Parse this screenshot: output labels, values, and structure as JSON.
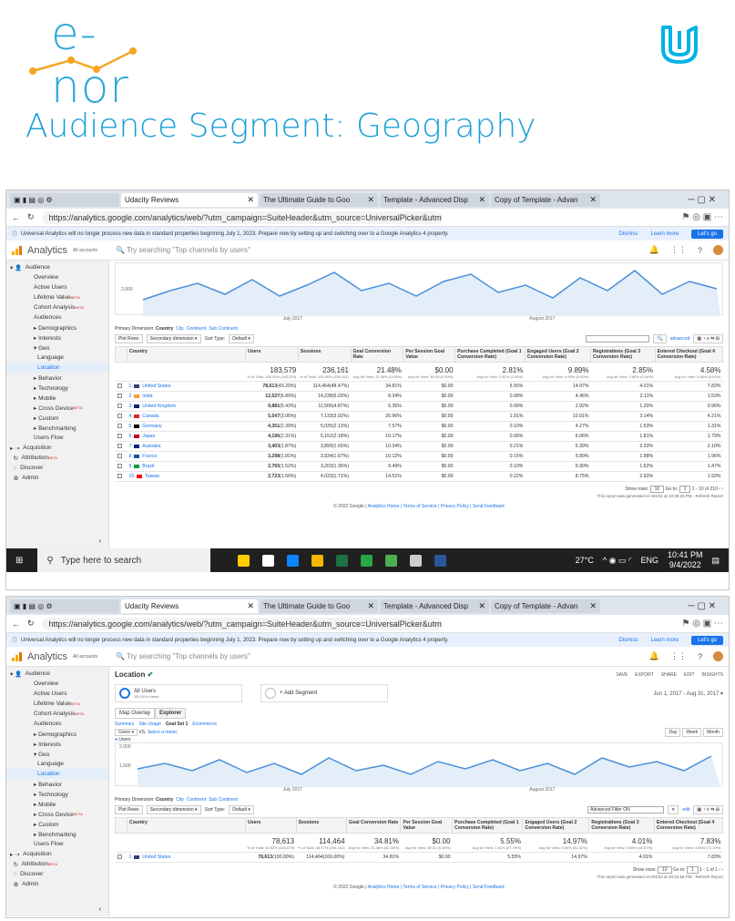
{
  "brand": {
    "name": "e-nor"
  },
  "headline": "Audience Segment: Geography",
  "browser": {
    "tabs": [
      "Udacity Reviews",
      "The Ultimate Guide to Goo",
      "Template - Advanced Disp",
      "Copy of Template - Advan"
    ],
    "url": "https://analytics.google.com/analytics/web/?utm_campaign=SuiteHeader&utm_source=UniversalPicker&utm...",
    "banner": "Universal Analytics will no longer process new data in standard properties beginning July 1, 2023. Prepare now by setting up and switching over to a Google Analytics 4 property.",
    "dismiss": "Dismiss",
    "learn_more": "Learn more",
    "lets_go": "Let's go"
  },
  "ga": {
    "app_name": "Analytics",
    "accounts_label": "All accounts",
    "search_placeholder": "Try searching \"Top channels by users\""
  },
  "sidebar": {
    "audience": "Audience",
    "items": [
      "Overview",
      "Active Users",
      "Lifetime Value",
      "Cohort Analysis",
      "Audiences",
      "▸ Demographics",
      "▸ Interests",
      "▾ Geo"
    ],
    "geo_sub": [
      "Language",
      "Location"
    ],
    "items2": [
      "▸ Behavior",
      "▸ Technology",
      "▸ Mobile",
      "▸ Cross Device",
      "▸ Custom",
      "▸ Benchmarking",
      "Users Flow"
    ],
    "acquisition": "Acquisition",
    "attribution": "Attribution",
    "discover": "Discover",
    "admin": "Admin",
    "beta": "BETA"
  },
  "chart": {
    "x_labels": [
      "July 2017",
      "August 2017"
    ],
    "y_top": "2,000",
    "y_mid": "1,000"
  },
  "primary": {
    "label": "Primary Dimension:",
    "selected": "Country",
    "options": [
      "City",
      "Continent",
      "Sub Continent"
    ]
  },
  "controls": {
    "plot_rows": "Plot Rows",
    "secondary": "Secondary dimension ▾",
    "sort": "Sort Type:",
    "default": "Default ▾",
    "advanced": "advanced",
    "filter_label": "Advanced Filter ON",
    "edit": "edit"
  },
  "table": {
    "headers": [
      "Country",
      "Users",
      "Sessions",
      "Goal Conversion Rate",
      "Per Session Goal Value",
      "Purchase Completed (Goal 1 Conversion Rate)",
      "Engaged Users (Goal 2 Conversion Rate)",
      "Registrations (Goal 3 Conversion Rate)",
      "Entered Checkout (Goal 4 Conversion Rate)"
    ],
    "totals": [
      "183,579",
      "236,161",
      "21.48%",
      "$0.00",
      "2.81%",
      "9.89%",
      "2.85%",
      "4.58%"
    ],
    "totals_sub": [
      "% of Total: 100.00% (183,579)",
      "% of Total: 100.00% (236,161)",
      "Avg for View: 21.48% (0.00%)",
      "Avg for View: $0.00 (0.00%)",
      "Avg for View: 2.81% (0.00%)",
      "Avg for View: 9.89% (0.00%)",
      "Avg for View: 2.85% (0.00%)",
      "Avg for View: 4.58% (0.00%)"
    ],
    "rows": [
      [
        "1.",
        "United States",
        "78,613",
        "(43.20%)",
        "114,464",
        "(48.47%)",
        "34.81%",
        "$0.00",
        "5.55%",
        "14.97%",
        "4.01%",
        "7.83%"
      ],
      [
        "2.",
        "India",
        "12,527",
        "(6.89%)",
        "14,238",
        "(6.03%)",
        "8.34%",
        "$0.00",
        "0.08%",
        "4.46%",
        "2.11%",
        "1.53%"
      ],
      [
        "3.",
        "United Kingdom",
        "9,881",
        "(5.43%)",
        "11,506",
        "(4.87%)",
        "5.35%",
        "$0.00",
        "0.09%",
        "2.92%",
        "1.20%",
        "0.90%"
      ],
      [
        "4.",
        "Canada",
        "5,547",
        "(3.05%)",
        "7,133",
        "(3.02%)",
        "20.96%",
        "$0.00",
        "1.91%",
        "10.91%",
        "3.14%",
        "4.21%"
      ],
      [
        "5.",
        "Germany",
        "4,351",
        "(2.39%)",
        "5,035",
        "(2.13%)",
        "7.57%",
        "$0.00",
        "0.10%",
        "4.27%",
        "1.53%",
        "1.31%"
      ],
      [
        "6.",
        "Japan",
        "4,196",
        "(2.31%)",
        "5,152",
        "(2.18%)",
        "10.17%",
        "$0.00",
        "0.06%",
        "6.06%",
        "1.81%",
        "1.79%"
      ],
      [
        "7.",
        "Australia",
        "3,403",
        "(1.87%)",
        "3,899",
        "(1.65%)",
        "10.34%",
        "$0.00",
        "0.21%",
        "5.39%",
        "2.33%",
        "2.10%"
      ],
      [
        "8.",
        "France",
        "3,298",
        "(1.81%)",
        "3,934",
        "(1.67%)",
        "10.12%",
        "$0.00",
        "0.15%",
        "5.80%",
        "1.88%",
        "1.96%"
      ],
      [
        "9.",
        "Brazil",
        "2,765",
        "(1.52%)",
        "3,203",
        "(1.36%)",
        "9.49%",
        "$0.00",
        "0.19%",
        "5.90%",
        "1.62%",
        "1.47%"
      ],
      [
        "10.",
        "Taiwan",
        "2,723",
        "(1.50%)",
        "4,033",
        "(1.71%)",
        "14.51%",
        "$0.00",
        "0.22%",
        "8.75%",
        "2.60%",
        "1.93%"
      ]
    ],
    "flag_colors": [
      "#3c3b6e",
      "#ff9933",
      "#012169",
      "#d52b1e",
      "#000000",
      "#bc002d",
      "#00247d",
      "#0055a4",
      "#009c3b",
      "#fe0000"
    ]
  },
  "pager": {
    "show_rows": "Show rows:",
    "rows": "10",
    "goto": "Go to:",
    "page": "1",
    "range": "1 - 10 of 210",
    "generated": "This report was generated on 9/4/22 at 10:39:25 PM - Refresh Report"
  },
  "pager2": {
    "range": "1 - 1 of 1",
    "generated": "This report was generated on 9/4/22 at 10:41:56 PM - Refresh Report"
  },
  "footer": {
    "copyright": "© 2022 Google |",
    "links": "Analytics Home | Terms of Service | Privacy Policy | Send Feedback"
  },
  "taskbar": {
    "search": "Type here to search",
    "temp": "27°C",
    "lang": "ENG",
    "time": "10:41 PM",
    "date": "9/4/2022"
  },
  "location_view": {
    "title": "Location",
    "tools": [
      "SAVE",
      "EXPORT",
      "SHARE",
      "EDIT",
      "INSIGHTS"
    ],
    "segment": "All Users",
    "segment_sub": "100.00% Users",
    "add_segment": "+ Add Segment",
    "date_range": "Jun 1, 2017 - Aug 31, 2017 ▾",
    "tabs": [
      "Map Overlay",
      "Explorer"
    ],
    "sublinks": [
      "Summary",
      "Site Usage",
      "Goal Set 1",
      "Ecommerce"
    ],
    "metric": "Users ▾",
    "vs": "VS.",
    "select_metric": "Select a metric",
    "period_btns": [
      "Day",
      "Week",
      "Month"
    ],
    "legend": "Users",
    "totals": [
      "78,613",
      "114,464",
      "34.81%",
      "$0.00",
      "5.55%",
      "14.97%",
      "4.01%",
      "7.83%"
    ],
    "totals_sub": [
      "% of Total: 42.82% (183,579)",
      "% of Total: 48.47% (236,161)",
      "Avg for View: 21.48% (62.05%)",
      "Avg for View: $0.00 (0.00%)",
      "Avg for View: 2.81% (97.79%)",
      "Avg for View: 9.89% (51.32%)",
      "Avg for View: 2.85% (40.57%)",
      "Avg for View: 4.58% (71.10%)"
    ],
    "row": [
      "1.",
      "United States",
      "78,613",
      "(100.00%)",
      "114,464",
      "(100.00%)",
      "34.81%",
      "$0.00",
      "5.55%",
      "14.97%",
      "4.01%",
      "7.83%"
    ]
  }
}
